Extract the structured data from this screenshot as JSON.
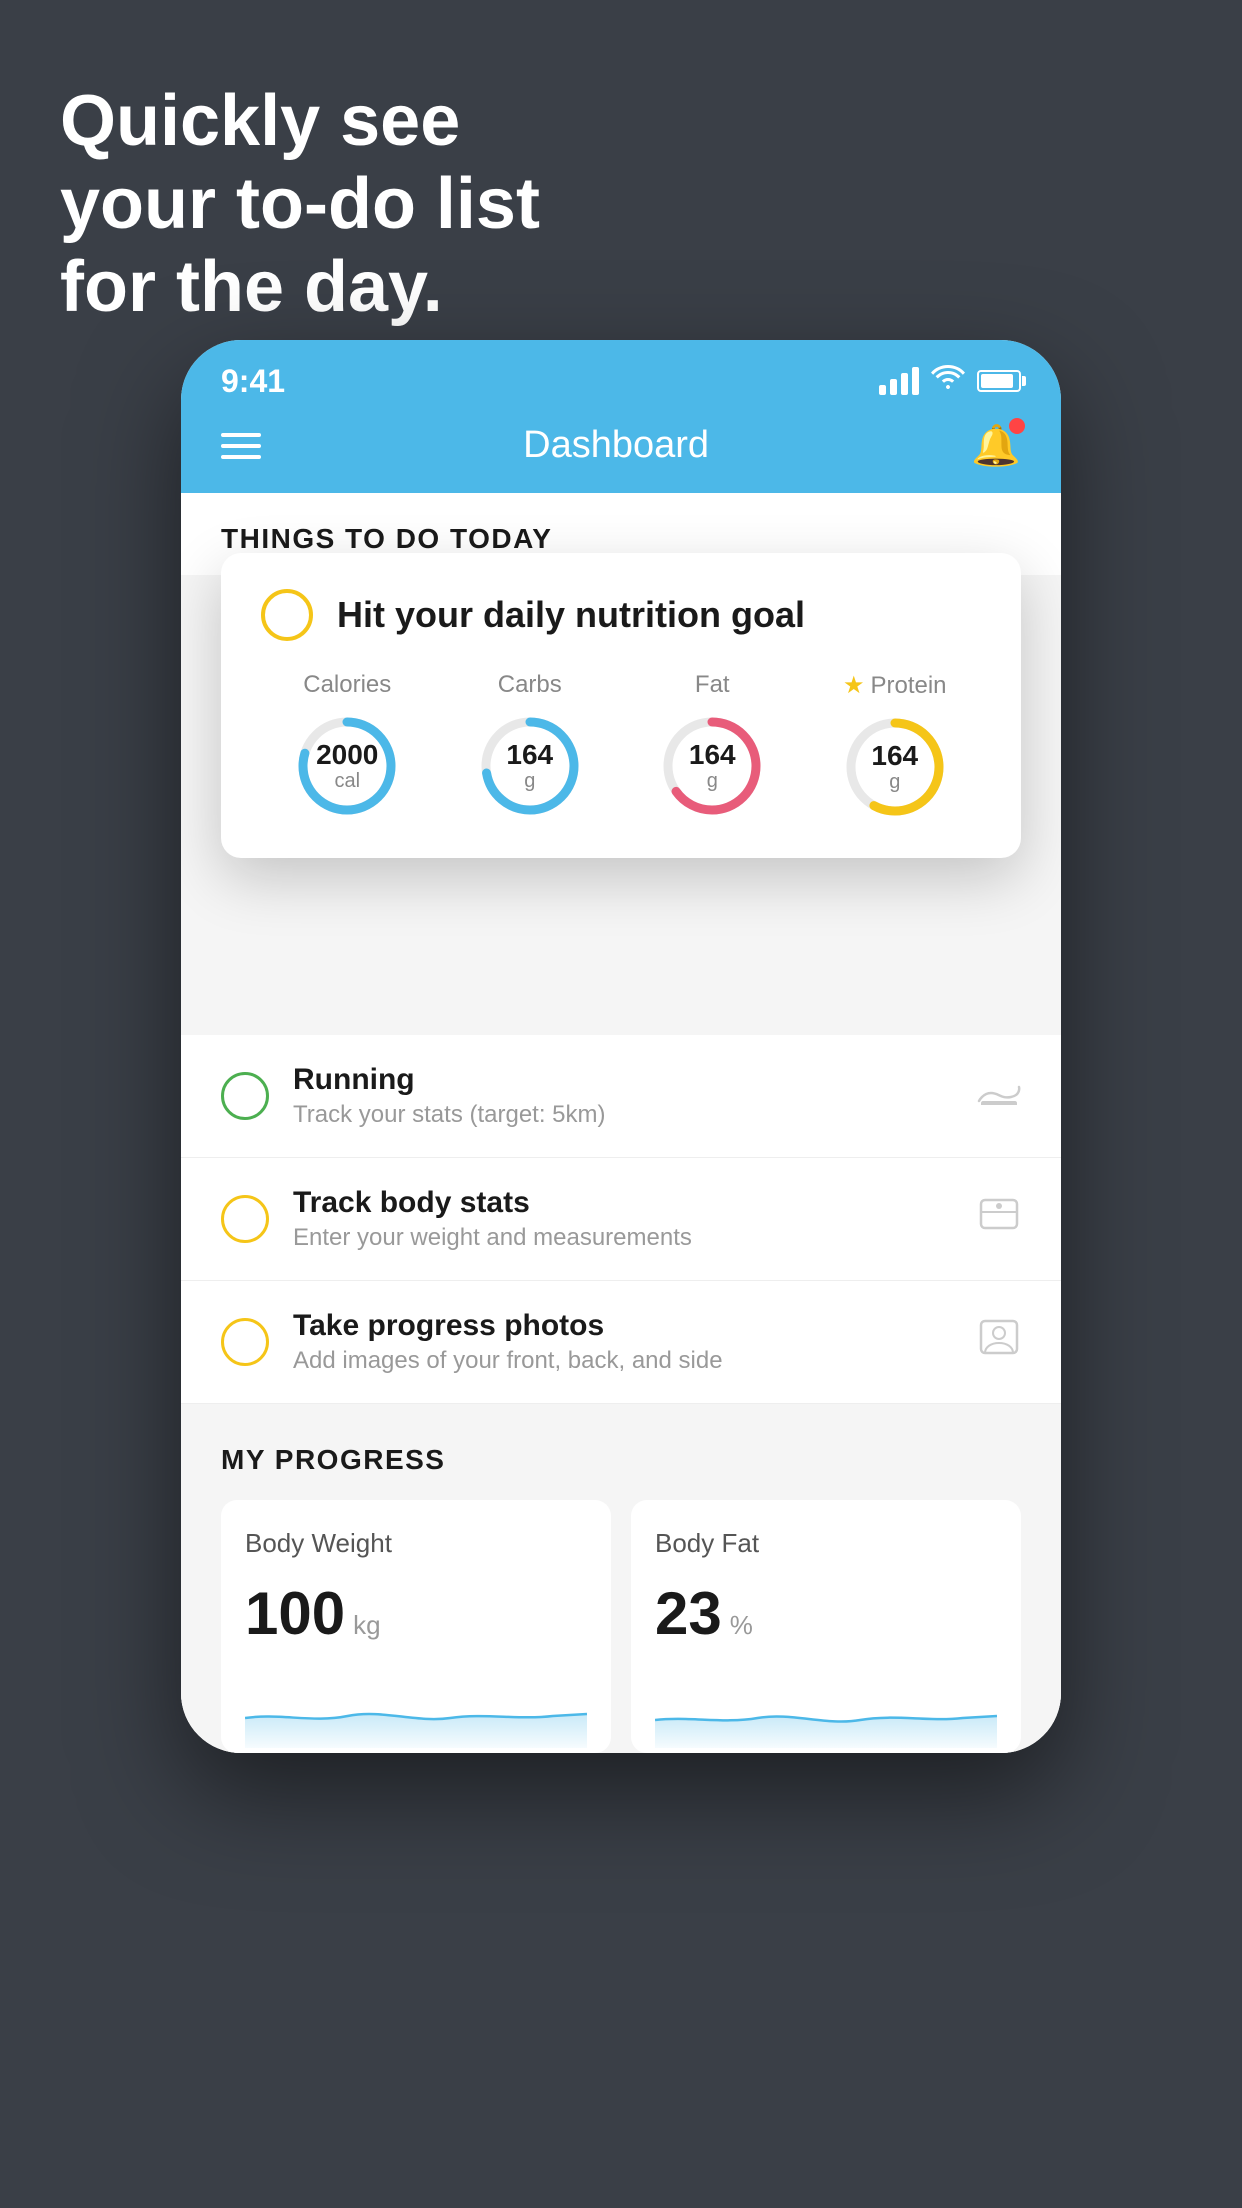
{
  "headline": {
    "line1": "Quickly see",
    "line2": "your to-do list",
    "line3": "for the day."
  },
  "status_bar": {
    "time": "9:41"
  },
  "nav": {
    "title": "Dashboard"
  },
  "things_section": {
    "title": "THINGS TO DO TODAY"
  },
  "floating_card": {
    "title": "Hit your daily nutrition goal",
    "items": [
      {
        "label": "Calories",
        "value": "2000",
        "unit": "cal",
        "color": "#4cb8e8",
        "star": false
      },
      {
        "label": "Carbs",
        "value": "164",
        "unit": "g",
        "color": "#4cb8e8",
        "star": false
      },
      {
        "label": "Fat",
        "value": "164",
        "unit": "g",
        "color": "#e85c7a",
        "star": false
      },
      {
        "label": "Protein",
        "value": "164",
        "unit": "g",
        "color": "#f5c518",
        "star": true
      }
    ]
  },
  "todo_items": [
    {
      "name": "Running",
      "desc": "Track your stats (target: 5km)",
      "circle_color": "green",
      "icon": "shoe"
    },
    {
      "name": "Track body stats",
      "desc": "Enter your weight and measurements",
      "circle_color": "yellow",
      "icon": "scale"
    },
    {
      "name": "Take progress photos",
      "desc": "Add images of your front, back, and side",
      "circle_color": "yellow",
      "icon": "camera"
    }
  ],
  "progress": {
    "title": "MY PROGRESS",
    "cards": [
      {
        "label": "Body Weight",
        "value": "100",
        "unit": "kg"
      },
      {
        "label": "Body Fat",
        "value": "23",
        "unit": "%"
      }
    ]
  }
}
